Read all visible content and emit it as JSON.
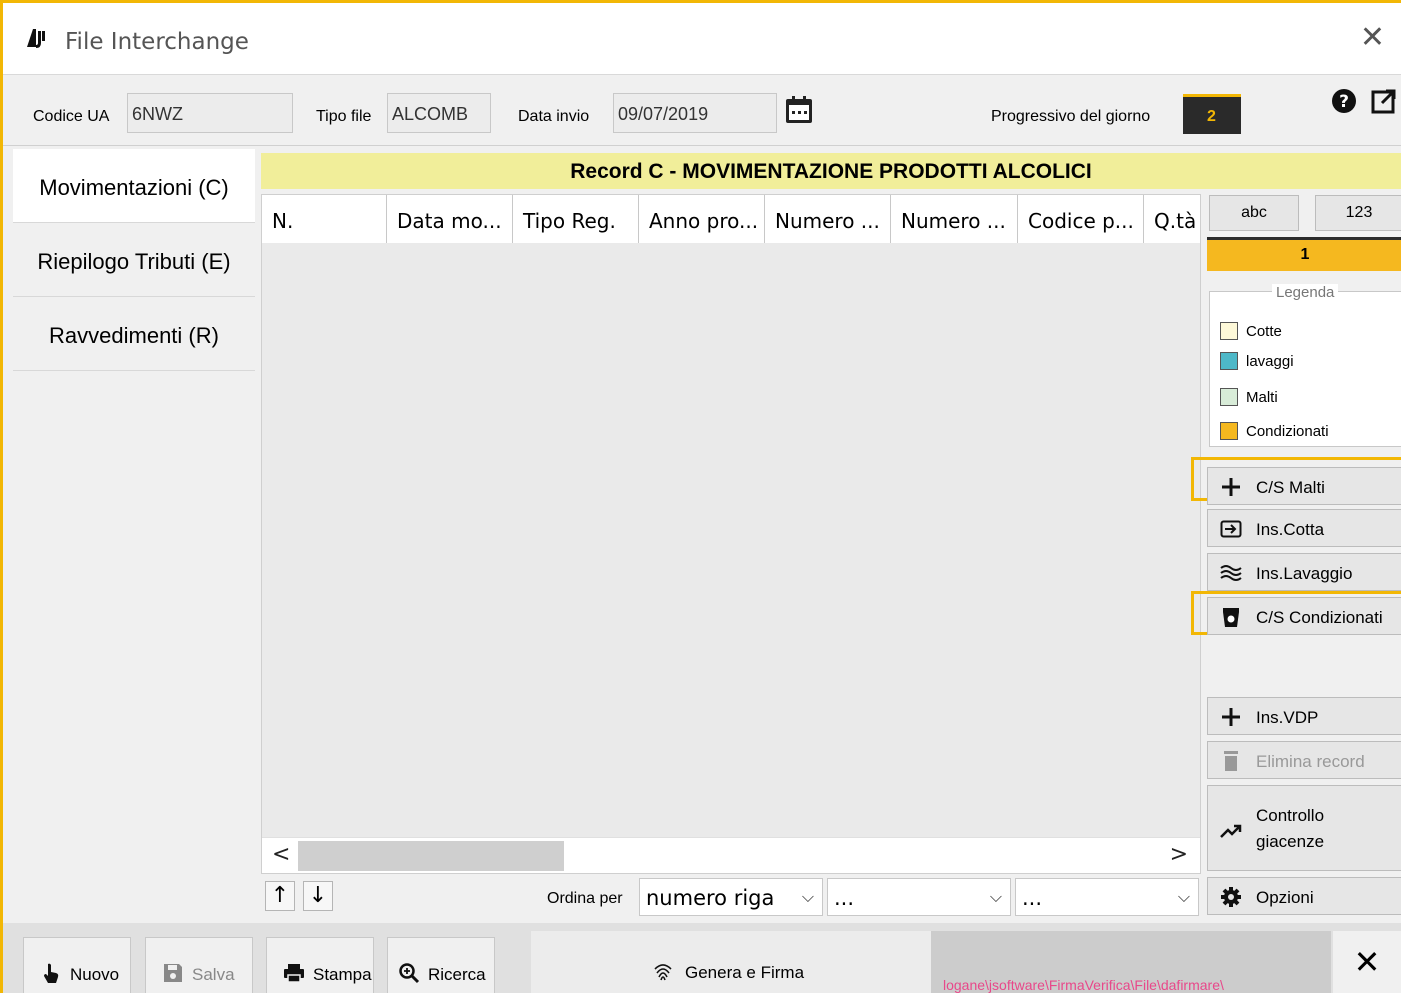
{
  "window": {
    "title": "File Interchange"
  },
  "header": {
    "codice_ua_label": "Codice UA",
    "codice_ua_value": "6NWZ",
    "tipo_file_label": "Tipo file",
    "tipo_file_value": "ALCOMB",
    "data_invio_label": "Data invio",
    "data_invio_value": "09/07/2019",
    "progressivo_label": "Progressivo del giorno",
    "progressivo_value": "2"
  },
  "sidebar": {
    "items": [
      {
        "label": "Movimentazioni (C)"
      },
      {
        "label": "Riepilogo Tributi (E)"
      },
      {
        "label": "Ravvedimenti (R)"
      }
    ]
  },
  "main": {
    "banner": "Record C  -  MOVIMENTAZIONE PRODOTTI ALCOLICI",
    "columns": [
      "N.",
      "Data mo...",
      "Tipo Reg.",
      "Anno pro...",
      "Numero ...",
      "Numero ...",
      "Codice p...",
      "Q.tà"
    ],
    "ordina_label": "Ordina per",
    "sort_selects": [
      "numero riga",
      "...",
      "..."
    ]
  },
  "right": {
    "mode_abc": "abc",
    "mode_123": "123",
    "counter": "1",
    "legend_title": "Legenda",
    "legend": [
      {
        "label": "Cotte",
        "color": "#fdf8d8"
      },
      {
        "label": "lavaggi",
        "color": "#4db8c8"
      },
      {
        "label": "Malti",
        "color": "#d8ecd8"
      },
      {
        "label": "Condizionati",
        "color": "#f5b81f"
      }
    ],
    "buttons": {
      "cs_malti": "C/S Malti",
      "ins_cotta": "Ins.Cotta",
      "ins_lavaggio": "Ins.Lavaggio",
      "cs_condizionati": "C/S Condizionati",
      "ins_vdp": "Ins.VDP",
      "elimina": "Elimina record",
      "controllo_1": "Controllo",
      "controllo_2": "giacenze",
      "opzioni": "Opzioni"
    }
  },
  "footer": {
    "nuovo": "Nuovo",
    "salva": "Salva",
    "stampa": "Stampa",
    "ricerca": "Ricerca",
    "genera": "Genera e Firma",
    "path": "logane\\jsoftware\\FirmaVerifica\\File\\dafirmare\\"
  },
  "colors": {
    "accent": "#f2b705",
    "banner": "#f1ee9a",
    "path_text": "#e8488a"
  }
}
